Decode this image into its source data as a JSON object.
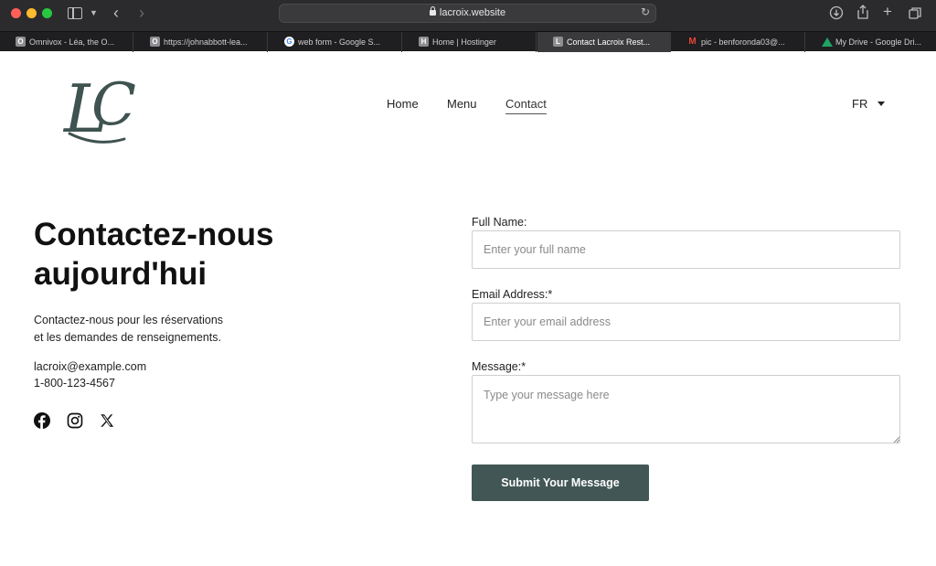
{
  "browser": {
    "url": "lacroix.website",
    "tabs": [
      {
        "label": "Omnivox - Léa, the O...",
        "favicon": "O"
      },
      {
        "label": "https://johnabbott-lea...",
        "favicon": "O"
      },
      {
        "label": "web form - Google S...",
        "favicon": "G"
      },
      {
        "label": "Home | Hostinger",
        "favicon": "H"
      },
      {
        "label": "Contact Lacroix Rest...",
        "favicon": "L"
      },
      {
        "label": "pic - benforonda03@...",
        "favicon": "M"
      },
      {
        "label": "My Drive - Google Dri...",
        "favicon": ""
      }
    ]
  },
  "header": {
    "logo_text": "LC",
    "nav": {
      "home": "Home",
      "menu": "Menu",
      "contact": "Contact"
    },
    "language": "FR"
  },
  "contact": {
    "heading_line1": "Contactez-nous",
    "heading_line2": "aujourd'hui",
    "intro_line1": "Contactez-nous pour les réservations",
    "intro_line2": "et les demandes de renseignements.",
    "email": "lacroix@example.com",
    "phone": "1-800-123-4567"
  },
  "form": {
    "name_label": "Full Name:",
    "name_placeholder": "Enter your full name",
    "email_label": "Email Address:*",
    "email_placeholder": "Enter your email address",
    "message_label": "Message:*",
    "message_placeholder": "Type your message here",
    "submit_label": "Submit Your Message"
  },
  "colors": {
    "brand": "#425755",
    "logo": "#3f5350",
    "chrome": "#2b2b2d"
  }
}
